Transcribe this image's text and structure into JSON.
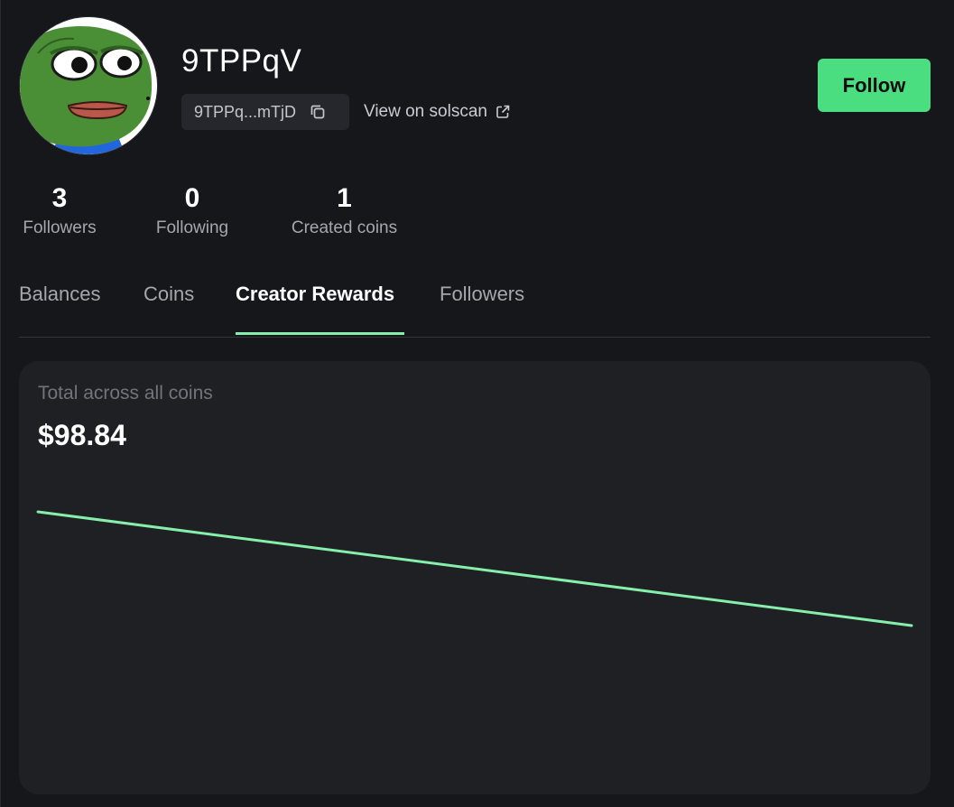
{
  "profile": {
    "username": "9TPPqV",
    "address_short": "9TPPq...mTjD",
    "solscan_label": "View on solscan",
    "follow_label": "Follow"
  },
  "stats": [
    {
      "value": "3",
      "label": "Followers"
    },
    {
      "value": "0",
      "label": "Following"
    },
    {
      "value": "1",
      "label": "Created coins"
    }
  ],
  "tabs": [
    {
      "label": "Balances"
    },
    {
      "label": "Coins"
    },
    {
      "label": "Creator Rewards",
      "active": true
    },
    {
      "label": "Followers"
    }
  ],
  "rewards": {
    "label": "Total across all coins",
    "total": "$98.84"
  },
  "chart_data": {
    "type": "line",
    "x": [
      0,
      1
    ],
    "values": [
      1.0,
      0.0
    ],
    "color": "#86efac"
  },
  "colors": {
    "accent": "#4ade80",
    "line": "#86efac",
    "background": "#16171b",
    "card": "#1f2023"
  }
}
